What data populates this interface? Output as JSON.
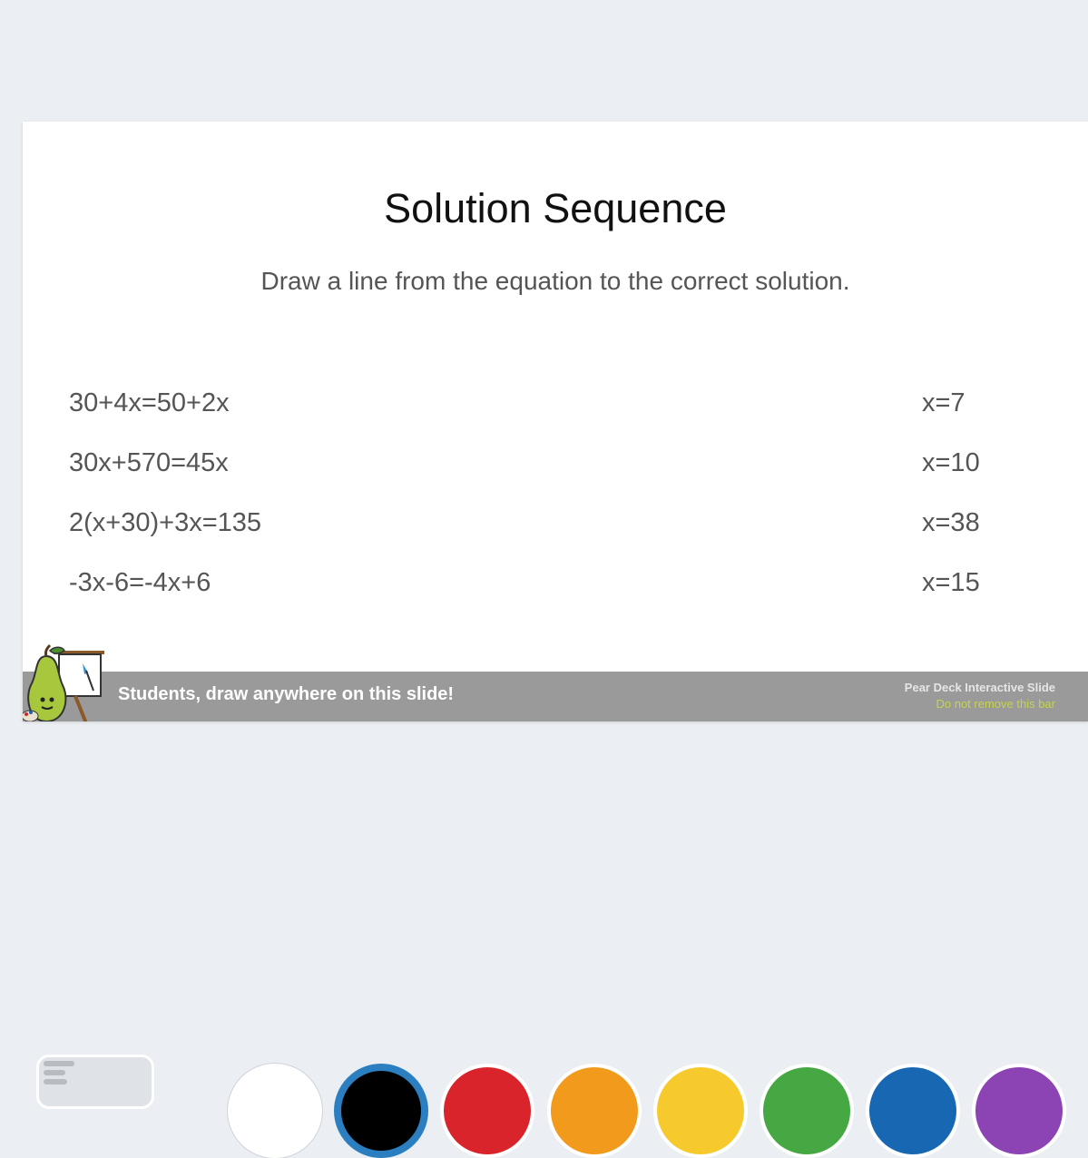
{
  "slide": {
    "title": "Solution Sequence",
    "subtitle": "Draw a line from the equation to the correct solution.",
    "equations": [
      "30+4x=50+2x",
      "30x+570=45x",
      "2(x+30)+3x=135",
      "-3x-6=-4x+6"
    ],
    "solutions": [
      "x=7",
      "x=10",
      "x=38",
      "x=15"
    ]
  },
  "footer": {
    "instruction": "Students, draw anywhere on this slide!",
    "brand": "Pear Deck Interactive Slide",
    "notice": "Do not remove this bar"
  },
  "toolbar": {
    "tool_icon": "pen-tool-icon",
    "colors": [
      {
        "name": "white",
        "hex": "#ffffff",
        "selected": false
      },
      {
        "name": "black",
        "hex": "#000000",
        "selected": true
      },
      {
        "name": "red",
        "hex": "#d8242a",
        "selected": false
      },
      {
        "name": "orange",
        "hex": "#f19a1c",
        "selected": false
      },
      {
        "name": "yellow",
        "hex": "#f6c92d",
        "selected": false
      },
      {
        "name": "green",
        "hex": "#45a842",
        "selected": false
      },
      {
        "name": "blue",
        "hex": "#1767b2",
        "selected": false
      },
      {
        "name": "purple",
        "hex": "#8c44b4",
        "selected": false
      }
    ]
  }
}
